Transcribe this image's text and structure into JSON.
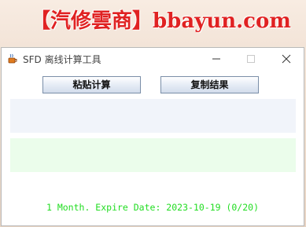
{
  "banner": {
    "text": "【汽修雲商】bbayun.com",
    "color": "#e02222"
  },
  "window": {
    "title": "SFD 离线计算工具",
    "icons": {
      "app": "java-cup-icon",
      "minimize": "minimize-icon",
      "maximize": "maximize-icon",
      "close": "close-icon"
    }
  },
  "toolbar": {
    "paste_compute_label": "粘贴计算",
    "copy_result_label": "复制结果"
  },
  "panels": {
    "input_color": "#f1f4fa",
    "result_color": "#ebfdeb"
  },
  "status": {
    "text": "1 Month. Expire Date: 2023-10-19  (0/20)",
    "color": "#22dd22"
  }
}
